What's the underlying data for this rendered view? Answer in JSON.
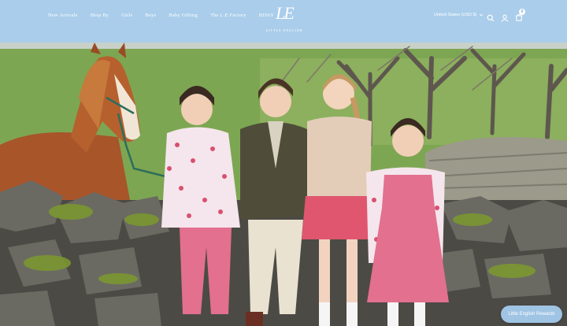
{
  "header": {
    "nav": [
      "New Arrivals",
      "Shop By",
      "Girls",
      "Boys",
      "Baby Gifting",
      "The L.E Factory",
      "BISSY"
    ],
    "logo_mark": "LE",
    "logo_text": "LITTLE ENGLISH",
    "region": "United States (USD $)",
    "cart_count": "0"
  },
  "icons": [
    "search-icon",
    "account-icon",
    "cart-icon",
    "chevron-down-icon"
  ],
  "rewards_button": "Little English Rewards",
  "colors": {
    "header_bg": "#a9cdea",
    "rewards_bg": "#9fc4e4",
    "dress_pink": "#e2708e"
  }
}
